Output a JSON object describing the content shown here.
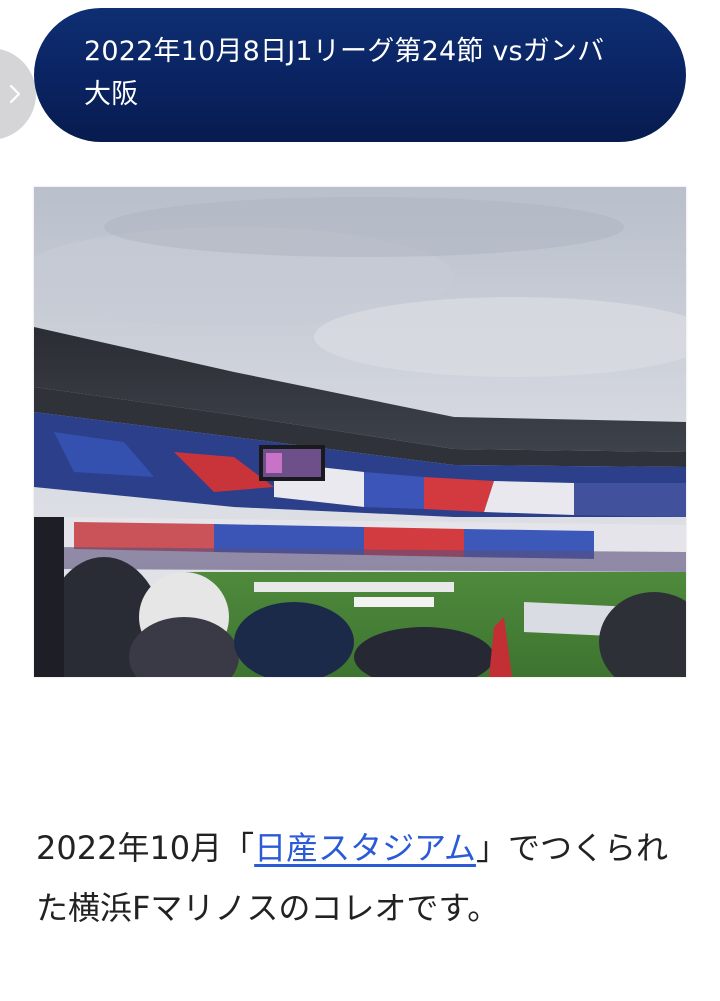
{
  "header": {
    "title": "2022年10月8日J1リーグ第24節 vsガンバ大阪",
    "side_tab_icon": "chevron-right-icon"
  },
  "photo": {
    "description_icon": "stadium-photo"
  },
  "caption": {
    "prefix": "2022年10月「",
    "link_text": "日産スタジアム",
    "suffix": "」でつくられた横浜Fマリノスのコレオです。"
  },
  "colors": {
    "title_bg": "#0a2361",
    "title_text": "#ffffff",
    "link": "#2a5ad6",
    "body_text": "#222222"
  }
}
